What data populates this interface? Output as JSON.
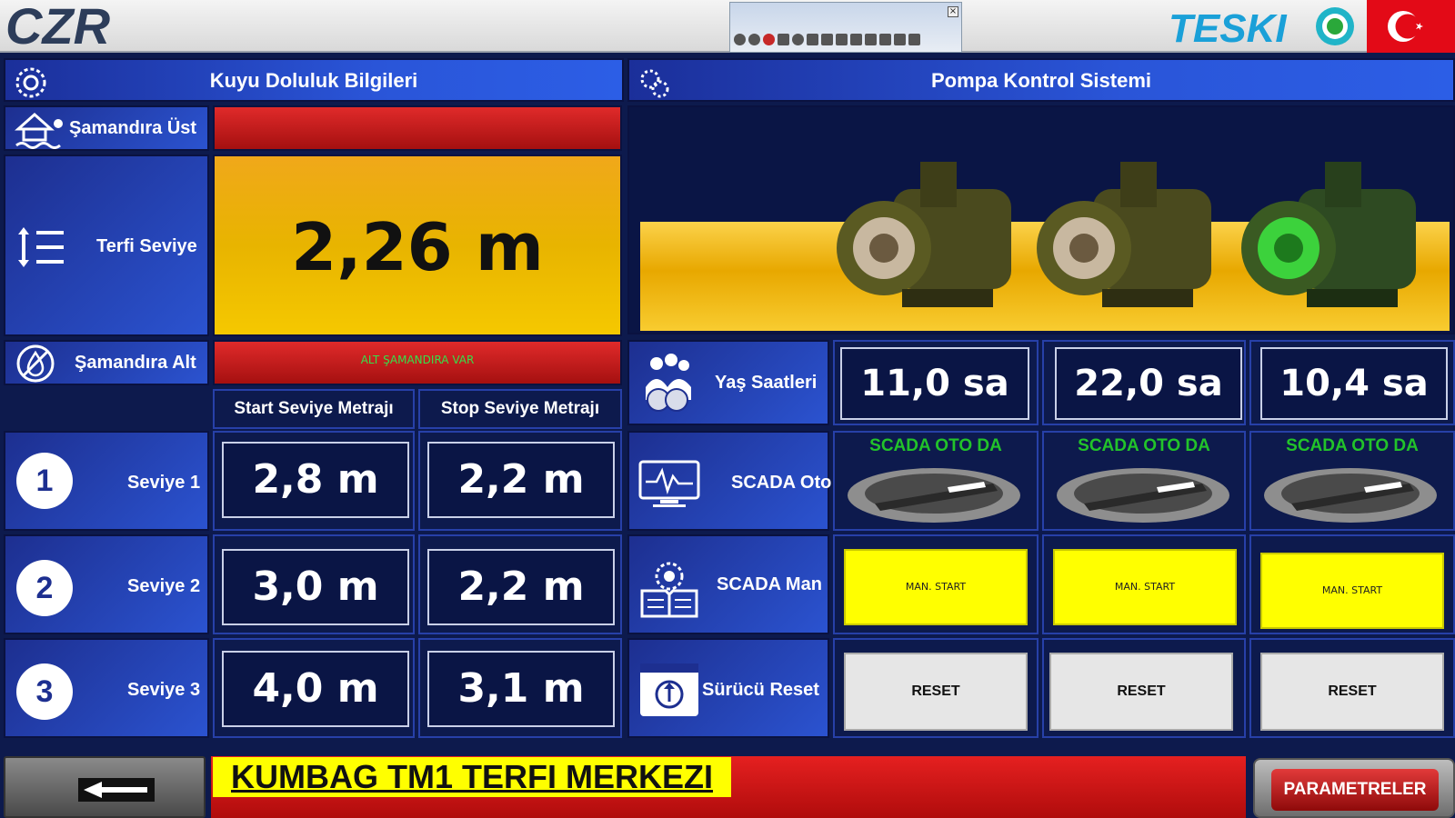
{
  "topbar": {
    "left_logo": "CZR",
    "right_logo": "TESKI",
    "toolbar_close": "×"
  },
  "well_panel": {
    "title": "Kuyu Doluluk Bilgileri",
    "float_top_label": "Şamandıra Üst",
    "level_label": "Terfi Seviye",
    "level_value": "2,26 m",
    "float_bottom_label": "Şamandıra Alt",
    "float_bottom_status": "ALT ŞAMANDIRA VAR",
    "col_start": "Start Seviye Metrajı",
    "col_stop": "Stop Seviye Metrajı",
    "levels": [
      {
        "num": "1",
        "label": "Seviye 1",
        "start": "2,8 m",
        "stop": "2,2 m"
      },
      {
        "num": "2",
        "label": "Seviye 2",
        "start": "3,0 m",
        "stop": "2,2 m"
      },
      {
        "num": "3",
        "label": "Seviye 3",
        "start": "4,0 m",
        "stop": "3,1 m"
      }
    ]
  },
  "pump_panel": {
    "title": "Pompa Kontrol Sistemi",
    "hours_label": "Yaş Saatleri",
    "scada_oto_label": "SCADA Oto",
    "scada_man_label": "SCADA Man",
    "reset_label": "Sürücü Reset",
    "pumps": [
      {
        "hours": "11,0 sa",
        "scada_status": "SCADA OTO DA",
        "man_button": "MAN. START",
        "reset_button": "RESET",
        "running": false
      },
      {
        "hours": "22,0 sa",
        "scada_status": "SCADA OTO DA",
        "man_button": "MAN. START",
        "reset_button": "RESET",
        "running": false
      },
      {
        "hours": "10,4 sa",
        "scada_status": "SCADA OTO DA",
        "man_button": "MAN. START",
        "reset_button": "RESET",
        "running": true
      }
    ]
  },
  "footer": {
    "station_title": "KUMBAG TM1 TERFI MERKEZI",
    "params_button": "PARAMETRELER"
  },
  "colors": {
    "panel_blue": "#2b53d0",
    "alarm_red": "#d01818",
    "level_amber": "#e8b400",
    "status_green": "#22c32a",
    "button_yellow": "#ffff00"
  }
}
